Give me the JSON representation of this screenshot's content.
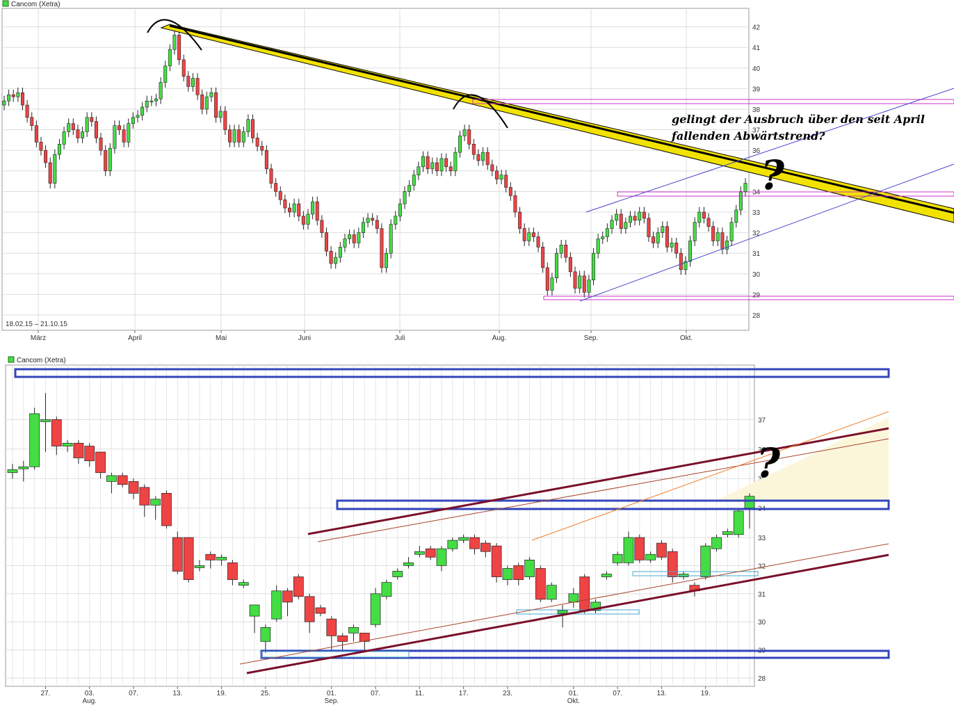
{
  "colors": {
    "up": "#44dd44",
    "down": "#ee4444",
    "grid": "#dddddd",
    "trendline": "#f2e200",
    "magenta": "#cc33cc",
    "blue_line": "#4444cc",
    "box_blue": "#3344bb",
    "dark_red": "#7a0f2a",
    "orange": "#f07c28",
    "cyan": "#44aacc"
  },
  "chart_data": [
    {
      "type": "candlestick",
      "legend_label": "Cancom (Xetra)",
      "date_range_label": "18.02.15 – 21.10.15",
      "ylim": [
        27.5,
        42.8
      ],
      "y_ticks": [
        28,
        29,
        30,
        31,
        32,
        33,
        34,
        35,
        36,
        37,
        38,
        39,
        40,
        41,
        42
      ],
      "x_tick_labels": [
        "März",
        "April",
        "Mai",
        "Juni",
        "Juli",
        "Aug.",
        "Sep.",
        "Okt."
      ],
      "annotation": [
        "gelingt der Ausbruch über den seit April",
        "fallenden Abwärtstrend?"
      ],
      "question_mark": "?",
      "closes": [
        38.4,
        38.7,
        38.6,
        38.8,
        38.2,
        37.6,
        37.2,
        36.4,
        36.0,
        35.4,
        34.4,
        35.8,
        36.3,
        36.9,
        37.3,
        37.0,
        36.6,
        36.9,
        37.6,
        37.4,
        36.6,
        36.0,
        35.0,
        36.1,
        37.2,
        37.0,
        36.4,
        37.3,
        37.6,
        37.7,
        38.1,
        38.4,
        38.4,
        38.5,
        39.3,
        40.1,
        40.9,
        41.6,
        40.4,
        39.6,
        39.1,
        39.5,
        38.7,
        38.0,
        38.6,
        38.8,
        37.6,
        37.9,
        37.0,
        36.4,
        37.0,
        36.4,
        36.9,
        37.5,
        36.6,
        36.2,
        36.0,
        35.1,
        34.4,
        34.0,
        33.6,
        33.2,
        33.0,
        33.4,
        32.8,
        32.4,
        32.9,
        33.5,
        32.6,
        32.0,
        31.1,
        30.5,
        30.8,
        31.3,
        31.7,
        31.9,
        31.5,
        32.0,
        32.5,
        32.7,
        32.6,
        32.2,
        30.3,
        31.0,
        32.4,
        32.8,
        33.4,
        34.0,
        34.3,
        34.8,
        35.2,
        35.7,
        35.1,
        35.4,
        35.0,
        35.6,
        35.2,
        35.0,
        35.9,
        36.7,
        37.0,
        36.3,
        35.8,
        35.5,
        35.9,
        35.3,
        35.0,
        34.6,
        34.8,
        34.2,
        33.8,
        33.0,
        32.2,
        31.6,
        32.0,
        31.8,
        31.3,
        30.3,
        29.2,
        29.8,
        31.0,
        31.4,
        30.8,
        30.1,
        29.3,
        29.9,
        29.1,
        29.7,
        31.0,
        31.7,
        31.8,
        32.2,
        32.6,
        32.9,
        32.2,
        32.5,
        32.8,
        32.6,
        33.0,
        32.7,
        31.8,
        31.5,
        32.0,
        32.3,
        31.3,
        31.5,
        31.0,
        30.2,
        30.6,
        31.6,
        32.5,
        33.0,
        32.7,
        32.3,
        31.6,
        32.0,
        31.2,
        31.6,
        32.5,
        33.1,
        34.0,
        34.4
      ]
    },
    {
      "type": "candlestick",
      "legend_label": "Cancom (Xetra)",
      "ylim": [
        27.8,
        37.6
      ],
      "y_ticks": [
        28,
        29,
        30,
        31,
        32,
        33,
        34,
        35,
        36,
        37
      ],
      "x_tick_labels": [
        "27.",
        "03.",
        "07.",
        "13.",
        "19.",
        "25.",
        "01.",
        "07.",
        "11.",
        "17.",
        "23.",
        "01.",
        "07.",
        "13.",
        "19."
      ],
      "month_labels": [
        "Aug.",
        "Sep.",
        "Okt."
      ],
      "question_mark": "?",
      "candles": [
        {
          "o": 35.2,
          "c": 35.3,
          "h": 35.5,
          "l": 35.0
        },
        {
          "o": 35.4,
          "c": 35.4,
          "h": 35.6,
          "l": 34.9
        },
        {
          "o": 35.4,
          "c": 37.2,
          "h": 37.4,
          "l": 35.3
        },
        {
          "o": 37.0,
          "c": 37.0,
          "h": 37.9,
          "l": 35.9
        },
        {
          "o": 37.0,
          "c": 36.1,
          "h": 37.1,
          "l": 35.8
        },
        {
          "o": 36.1,
          "c": 36.2,
          "h": 36.3,
          "l": 35.9
        },
        {
          "o": 36.2,
          "c": 35.7,
          "h": 36.3,
          "l": 35.5
        },
        {
          "o": 36.1,
          "c": 35.6,
          "h": 36.2,
          "l": 35.4
        },
        {
          "o": 35.9,
          "c": 35.2,
          "h": 35.9,
          "l": 35.0
        },
        {
          "o": 34.9,
          "c": 35.1,
          "h": 35.2,
          "l": 34.5
        },
        {
          "o": 35.1,
          "c": 34.8,
          "h": 35.2,
          "l": 34.7
        },
        {
          "o": 34.9,
          "c": 34.5,
          "h": 35.0,
          "l": 34.3
        },
        {
          "o": 34.7,
          "c": 34.1,
          "h": 34.8,
          "l": 33.7
        },
        {
          "o": 34.1,
          "c": 34.3,
          "h": 34.4,
          "l": 33.6
        },
        {
          "o": 34.5,
          "c": 33.4,
          "h": 34.6,
          "l": 33.3
        },
        {
          "o": 33.0,
          "c": 31.8,
          "h": 33.2,
          "l": 31.7
        },
        {
          "o": 33.0,
          "c": 31.5,
          "h": 33.0,
          "l": 31.4
        },
        {
          "o": 32.0,
          "c": 32.0,
          "h": 32.2,
          "l": 31.8
        },
        {
          "o": 32.4,
          "c": 32.2,
          "h": 32.5,
          "l": 31.9
        },
        {
          "o": 32.2,
          "c": 32.3,
          "h": 32.4,
          "l": 32.0
        },
        {
          "o": 32.1,
          "c": 31.5,
          "h": 32.2,
          "l": 31.3
        },
        {
          "o": 31.3,
          "c": 31.4,
          "h": 31.5,
          "l": 31.2
        },
        {
          "o": 30.2,
          "c": 30.6,
          "h": 30.6,
          "l": 29.6
        },
        {
          "o": 29.3,
          "c": 29.8,
          "h": 29.9,
          "l": 28.9
        },
        {
          "o": 30.1,
          "c": 31.1,
          "h": 31.3,
          "l": 30.0
        },
        {
          "o": 31.1,
          "c": 30.7,
          "h": 31.2,
          "l": 30.2
        },
        {
          "o": 31.6,
          "c": 30.9,
          "h": 31.7,
          "l": 30.8
        },
        {
          "o": 30.9,
          "c": 30.0,
          "h": 31.0,
          "l": 29.6
        },
        {
          "o": 30.5,
          "c": 30.3,
          "h": 30.6,
          "l": 30.2
        },
        {
          "o": 30.1,
          "c": 29.5,
          "h": 30.2,
          "l": 29.0
        },
        {
          "o": 29.5,
          "c": 29.3,
          "h": 29.6,
          "l": 29.0
        },
        {
          "o": 29.6,
          "c": 29.8,
          "h": 29.9,
          "l": 29.3
        },
        {
          "o": 29.6,
          "c": 29.3,
          "h": 29.6,
          "l": 29.0
        },
        {
          "o": 29.9,
          "c": 31.0,
          "h": 31.2,
          "l": 29.8
        },
        {
          "o": 30.9,
          "c": 31.4,
          "h": 31.5,
          "l": 30.8
        },
        {
          "o": 31.6,
          "c": 31.8,
          "h": 31.9,
          "l": 31.5
        },
        {
          "o": 32.0,
          "c": 32.1,
          "h": 32.3,
          "l": 31.9
        },
        {
          "o": 32.4,
          "c": 32.5,
          "h": 32.7,
          "l": 32.3
        },
        {
          "o": 32.6,
          "c": 32.3,
          "h": 32.7,
          "l": 32.2
        },
        {
          "o": 32.0,
          "c": 32.6,
          "h": 32.7,
          "l": 31.8
        },
        {
          "o": 32.6,
          "c": 32.9,
          "h": 33.0,
          "l": 32.5
        },
        {
          "o": 32.9,
          "c": 33.0,
          "h": 33.1,
          "l": 32.8
        },
        {
          "o": 33.0,
          "c": 32.6,
          "h": 33.1,
          "l": 32.4
        },
        {
          "o": 32.8,
          "c": 32.5,
          "h": 32.9,
          "l": 32.3
        },
        {
          "o": 32.7,
          "c": 31.6,
          "h": 32.8,
          "l": 31.4
        },
        {
          "o": 31.5,
          "c": 31.9,
          "h": 32.0,
          "l": 31.3
        },
        {
          "o": 32.0,
          "c": 31.5,
          "h": 32.1,
          "l": 31.3
        },
        {
          "o": 31.6,
          "c": 32.2,
          "h": 32.3,
          "l": 31.5
        },
        {
          "o": 31.9,
          "c": 30.8,
          "h": 32.0,
          "l": 30.7
        },
        {
          "o": 30.8,
          "c": 31.3,
          "h": 31.4,
          "l": 30.7
        },
        {
          "o": 30.3,
          "c": 30.4,
          "h": 30.6,
          "l": 29.8
        },
        {
          "o": 30.7,
          "c": 31.0,
          "h": 31.2,
          "l": 30.5
        },
        {
          "o": 31.6,
          "c": 30.4,
          "h": 31.7,
          "l": 30.3
        },
        {
          "o": 30.4,
          "c": 30.7,
          "h": 30.8,
          "l": 30.3
        },
        {
          "o": 31.6,
          "c": 31.7,
          "h": 31.8,
          "l": 31.5
        },
        {
          "o": 32.1,
          "c": 32.4,
          "h": 32.5,
          "l": 32.0
        },
        {
          "o": 32.1,
          "c": 33.0,
          "h": 33.2,
          "l": 32.0
        },
        {
          "o": 33.0,
          "c": 32.2,
          "h": 33.1,
          "l": 32.1
        },
        {
          "o": 32.2,
          "c": 32.4,
          "h": 32.5,
          "l": 32.1
        },
        {
          "o": 32.8,
          "c": 32.3,
          "h": 32.9,
          "l": 32.2
        },
        {
          "o": 32.5,
          "c": 31.6,
          "h": 32.6,
          "l": 31.4
        },
        {
          "o": 31.6,
          "c": 31.7,
          "h": 31.8,
          "l": 31.5
        },
        {
          "o": 31.3,
          "c": 31.1,
          "h": 31.4,
          "l": 30.9
        },
        {
          "o": 31.6,
          "c": 32.7,
          "h": 32.8,
          "l": 31.5
        },
        {
          "o": 32.6,
          "c": 33.0,
          "h": 33.1,
          "l": 32.5
        },
        {
          "o": 33.1,
          "c": 33.2,
          "h": 33.3,
          "l": 33.0
        },
        {
          "o": 33.1,
          "c": 33.9,
          "h": 34.0,
          "l": 33.0
        },
        {
          "o": 34.0,
          "c": 34.4,
          "h": 34.5,
          "l": 33.3
        }
      ]
    }
  ]
}
